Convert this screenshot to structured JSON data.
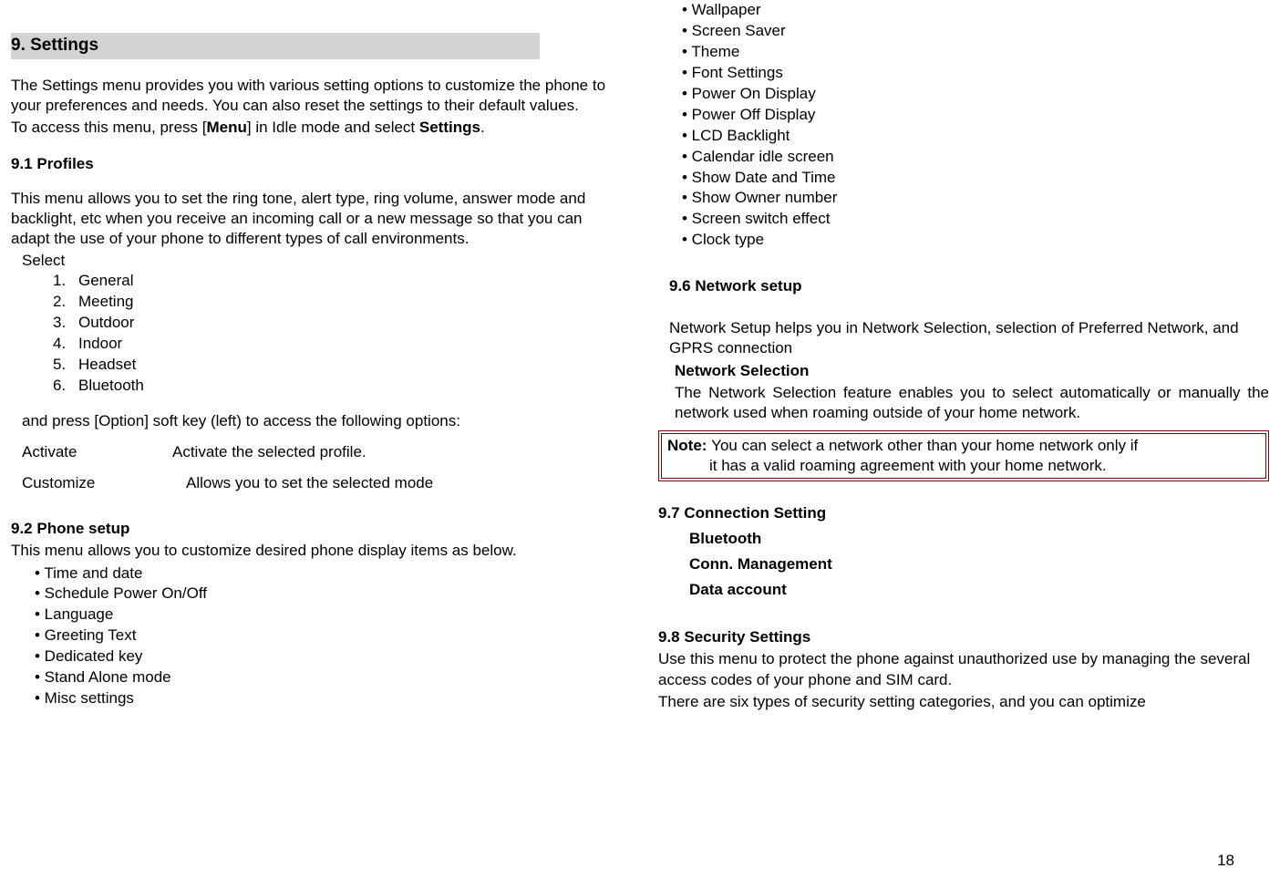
{
  "left": {
    "header": "9. Settings",
    "intro1": "The Settings menu provides you with various setting options to customize the phone to your preferences and needs. You can also reset the settings to their default values.",
    "intro2_a": "To access this menu, press [",
    "intro2_menu": "Menu",
    "intro2_b": "] in Idle mode and select ",
    "intro2_settings": "Settings",
    "intro2_c": ".",
    "h91": "9.1 Profiles",
    "p91": "This menu allows you to set the ring tone, alert type, ring volume, answer mode and backlight, etc when you receive an incoming call or a new message so that you can adapt the use of your phone to different types of call environments.",
    "select_label": "Select",
    "profiles": [
      {
        "n": "1.",
        "t": "General"
      },
      {
        "n": "2.",
        "t": "Meeting"
      },
      {
        "n": "3.",
        "t": "Outdoor"
      },
      {
        "n": "4.",
        "t": "Indoor"
      },
      {
        "n": "5.",
        "t": "Headset"
      },
      {
        "n": "6.",
        "t": "Bluetooth"
      }
    ],
    "p91b": "and press [Option] soft key (left) to access the following options:",
    "opt_activate": "Activate",
    "opt_activate_desc": "Activate the selected profile.",
    "opt_customize": "Customize",
    "opt_customize_desc": "Allows you to set the selected mode",
    "h92": "9.2 Phone setup",
    "p92": "This menu allows you to customize desired phone display items as below.",
    "phone_setup_items": [
      "• Time and date",
      "• Schedule Power On/Off",
      "• Language",
      "• Greeting Text",
      "• Dedicated key",
      "• Stand Alone mode",
      "• Misc settings"
    ]
  },
  "right": {
    "display_items": [
      "• Wallpaper",
      "• Screen Saver",
      "• Theme",
      "• Font Settings",
      "• Power On Display",
      "• Power Off Display",
      "• LCD Backlight",
      "• Calendar idle screen",
      "• Show Date and Time",
      "• Show Owner number",
      "• Screen switch effect",
      "• Clock type"
    ],
    "h96": "9.6 Network setup",
    "p96": "Network Setup helps you in Network Selection, selection of Preferred Network, and GPRS connection",
    "ns_title": "Network Selection",
    "ns_body": "The Network Selection feature enables you to select automatically or manually the network used when roaming outside of your home network.",
    "note_label": "Note: ",
    "note_line1": "You can select a network other than your home network only if",
    "note_line2": "it has a valid roaming agreement with your home network.",
    "h97": "9.7 Connection Setting",
    "conn_items": [
      "Bluetooth",
      "Conn. Management",
      "Data account"
    ],
    "h98": "9.8 Security Settings",
    "p98a": "Use this menu to protect the phone against unauthorized use by managing the several access codes of your phone and SIM card.",
    "p98b": "There are six types of security setting categories, and you can optimize"
  },
  "page_number": "18"
}
